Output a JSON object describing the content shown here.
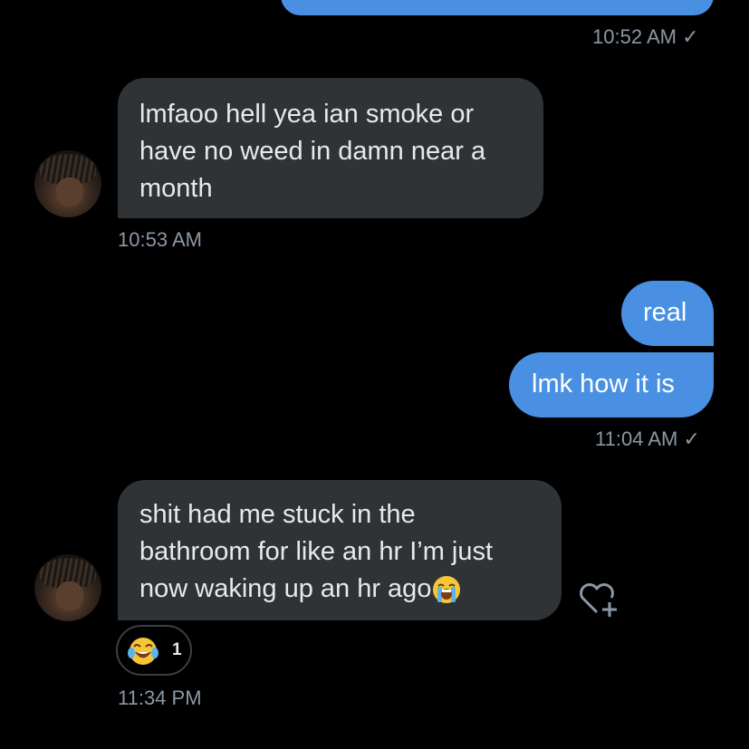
{
  "messages": [
    {
      "id": "m0",
      "direction": "out",
      "text": "",
      "timestamp": "10:52 AM",
      "read_mark": "✓"
    },
    {
      "id": "m1",
      "direction": "in",
      "text": "lmfaoo hell yea ian smoke or have no weed in damn near a month",
      "lines": [
        "lmfaoo hell yea ian smoke or",
        "have no weed in damn near a",
        "month"
      ],
      "timestamp": "10:53 AM"
    },
    {
      "id": "m2",
      "direction": "out",
      "text": "real"
    },
    {
      "id": "m3",
      "direction": "out",
      "text": "lmk how it is",
      "timestamp": "11:04 AM",
      "read_mark": "✓"
    },
    {
      "id": "m4",
      "direction": "in",
      "lines": [
        "shit had me stuck in the",
        "bathroom for like an hr I’m just",
        "now waking up an hr ago"
      ],
      "emoji": "loudly-crying-face",
      "reaction": {
        "emoji": "face-with-tears-of-joy",
        "count": "1"
      },
      "timestamp": "11:34 PM"
    }
  ],
  "icons": {
    "react": "heart-plus-icon",
    "avatar": "contact-avatar"
  },
  "colors": {
    "background": "#000000",
    "outgoing_bubble": "#4a90e2",
    "incoming_bubble": "#2f3336",
    "meta_text": "#8b98a5"
  }
}
